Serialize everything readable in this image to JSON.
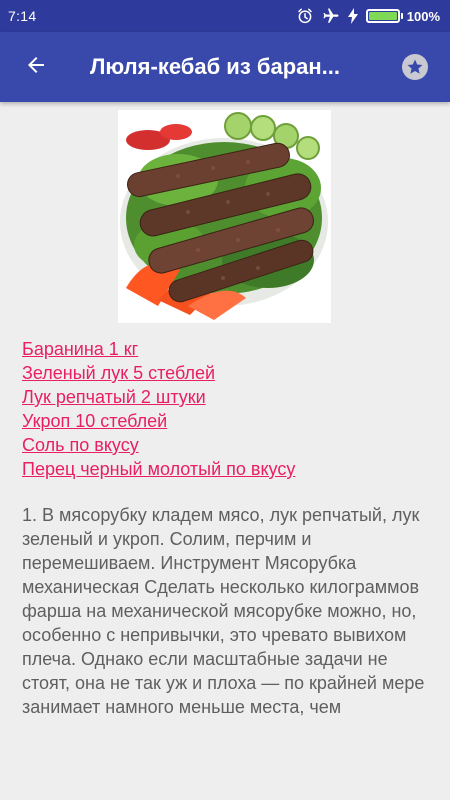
{
  "status_bar": {
    "time": "7:14",
    "battery_percent": "100%",
    "battery_level": 1.0,
    "icons": [
      "alarm-icon",
      "airplane-mode-icon",
      "charging-icon",
      "battery-icon"
    ],
    "colors": {
      "battery_fill": "#7ed957",
      "background": "#2f3b9c"
    }
  },
  "app_bar": {
    "title": "Люля-кебаб из баран...",
    "back_icon": "arrow-back-icon",
    "favorite_icon": "star-icon",
    "colors": {
      "background": "#3949ab"
    }
  },
  "recipe": {
    "image": "kebab-dish-photo",
    "ingredients": [
      "Баранина 1 кг",
      "Зеленый лук 5 стеблей",
      "Лук репчатый 2 штуки",
      "Укроп 10 стеблей",
      "Соль по вкусу",
      "Перец черный молотый по вкусу"
    ],
    "instructions": "1. В мясорубку кладем мясо, лук репчатый, лук зеленый и укроп. Солим, перчим и перемешиваем. Инструмент Мясорубка механическая Сделать несколько килограммов фарша на механической мясорубке можно, но, особенно с непривычки, это чревато вывихом плеча. Однако если масштабные задачи не стоят, она не так уж и плоха — по крайней мере занимает намного меньше места, чем",
    "colors": {
      "ingredient_link": "#e91e63",
      "body_text": "#5f5f5f"
    }
  }
}
